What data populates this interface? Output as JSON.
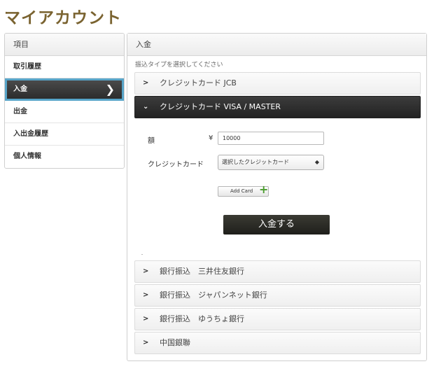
{
  "page": {
    "title": "マイアカウント"
  },
  "sidebar": {
    "header": "項目",
    "items": [
      {
        "label": "取引履歴"
      },
      {
        "label": "入金",
        "chevron": "❯"
      },
      {
        "label": "出金"
      },
      {
        "label": "入出金履歴"
      },
      {
        "label": "個人情報"
      }
    ],
    "active_index": 1,
    "active_border_color": "#58a5c9"
  },
  "main": {
    "header": "入金",
    "subtitle": "振込タイプを選択してください",
    "accordions": [
      {
        "label": "クレジットカード JCB",
        "icon": "chevron-right-icon",
        "open": false
      },
      {
        "label": "クレジットカード VISA / MASTER",
        "icon": "chevron-down-icon",
        "open": true
      },
      {
        "label": "銀行振込　三井住友銀行",
        "icon": "chevron-right-icon",
        "open": false
      },
      {
        "label": "銀行振込　ジャパンネット銀行",
        "icon": "chevron-right-icon",
        "open": false
      },
      {
        "label": "銀行振込　ゆうちょ銀行",
        "icon": "chevron-right-icon",
        "open": false
      },
      {
        "label": "中国銀聯",
        "icon": "chevron-right-icon",
        "open": false
      }
    ],
    "form": {
      "amount_label": "額",
      "currency_symbol": "¥",
      "amount_value": "10000",
      "card_label": "クレジットカード",
      "card_select_value": "選択したクレジットカード",
      "add_card_label": "Add Card",
      "add_card_icon": "plus-icon",
      "submit_label": "入金する"
    }
  },
  "colors": {
    "title": "#7a6330",
    "plus": "#4a9c2e",
    "dark_button": "#2a2a25"
  }
}
